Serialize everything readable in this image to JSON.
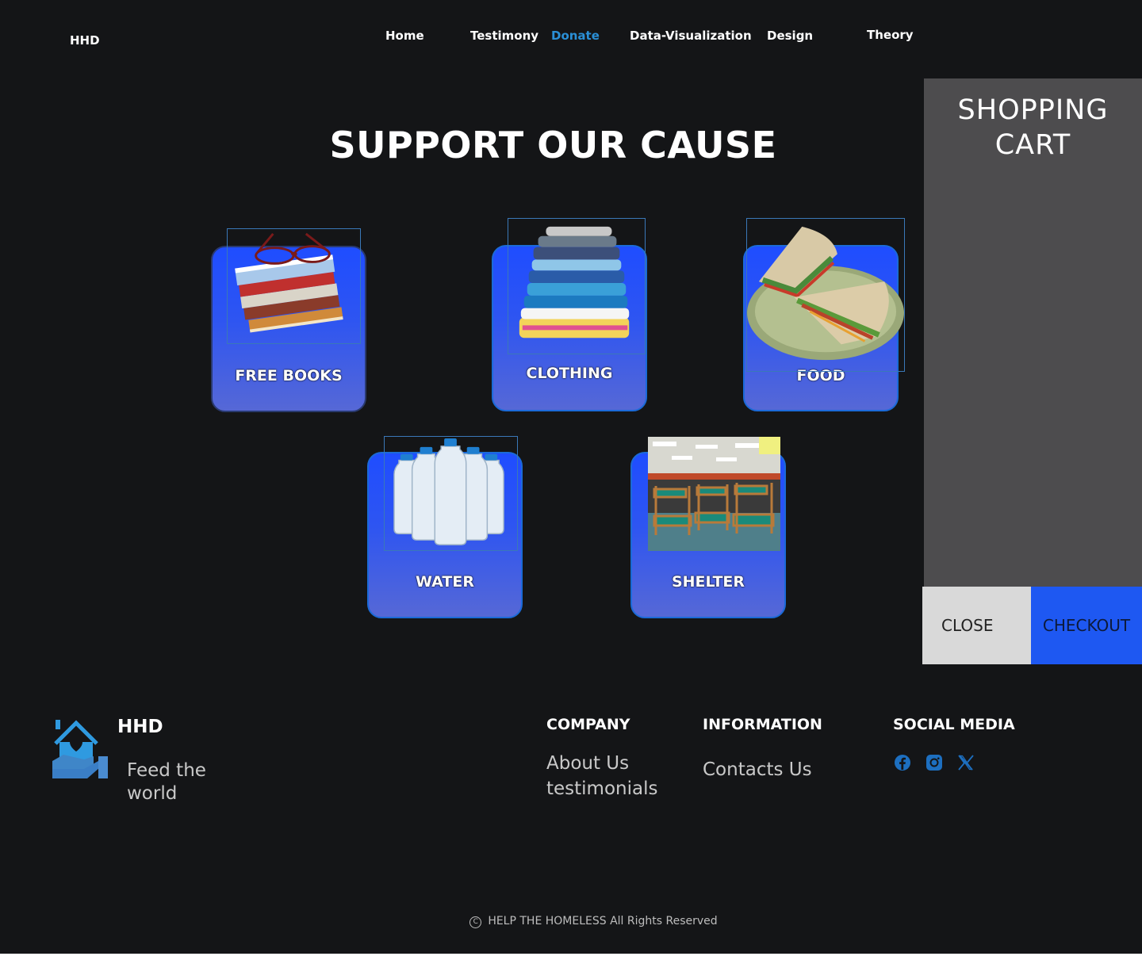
{
  "brand": {
    "logo_text": "HHD"
  },
  "nav": {
    "items": [
      {
        "label": "Home"
      },
      {
        "label": "Testimony"
      },
      {
        "label": "Donate"
      },
      {
        "label": "Data-Visualization"
      },
      {
        "label": "Design"
      },
      {
        "label": "Theory"
      }
    ],
    "active": "Donate",
    "active_color": "#2a8fd6"
  },
  "main": {
    "title": "SUPPORT OUR CAUSE",
    "cards": [
      {
        "label": "FREE BOOKS",
        "image": "stack-of-books-with-glasses"
      },
      {
        "label": "CLOTHING",
        "image": "stack-of-folded-clothes"
      },
      {
        "label": "FOOD",
        "image": "sandwich-on-plate"
      },
      {
        "label": "WATER",
        "image": "water-bottles"
      },
      {
        "label": "SHELTER",
        "image": "shelter-bunk-beds"
      }
    ]
  },
  "cart": {
    "title_line1": "SHOPPING",
    "title_line2": "CART",
    "close_label": "CLOSE",
    "checkout_label": "CHECKOUT"
  },
  "footer": {
    "brand": "HHD",
    "tagline": "Feed the world",
    "company": {
      "heading": "COMPANY",
      "links": [
        "About Us",
        "testimonials"
      ]
    },
    "information": {
      "heading": "INFORMATION",
      "links": [
        "Contacts Us"
      ]
    },
    "social": {
      "heading": "SOCIAL MEDIA",
      "icons": [
        "facebook-icon",
        "instagram-icon",
        "x-icon"
      ]
    },
    "copyright": "HELP THE HOMELESS All Rights Reserved"
  },
  "colors": {
    "background": "#141517",
    "card_blue": "#1f4dff",
    "cart_panel": "#4d4c4e",
    "checkout_blue": "#1e58f2",
    "social_icon": "#1d6fc0"
  }
}
